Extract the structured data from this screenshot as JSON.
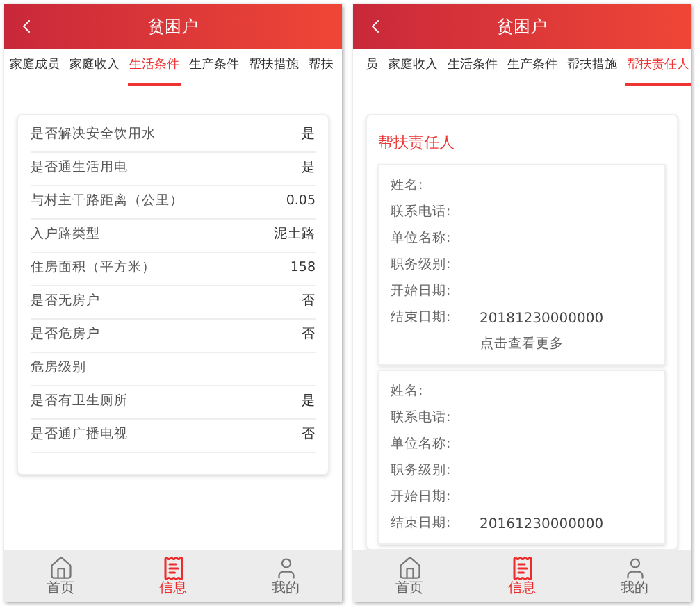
{
  "screens": [
    {
      "title": "贫困户",
      "tabs": [
        {
          "label": "家庭成员",
          "selected": false
        },
        {
          "label": "家庭收入",
          "selected": false
        },
        {
          "label": "生活条件",
          "selected": true
        },
        {
          "label": "生产条件",
          "selected": false
        },
        {
          "label": "帮扶措施",
          "selected": false
        },
        {
          "label": "帮扶",
          "selected": false
        }
      ],
      "content": {
        "kind": "table",
        "rows": [
          {
            "label": "是否解决安全饮用水",
            "value": "是"
          },
          {
            "label": "是否通生活用电",
            "value": "是"
          },
          {
            "label": "与村主干路距离（公里）",
            "value": "0.05"
          },
          {
            "label": "入户路类型",
            "value": "泥土路"
          },
          {
            "label": "住房面积（平方米）",
            "value": "158"
          },
          {
            "label": "是否无房户",
            "value": "否"
          },
          {
            "label": "是否危房户",
            "value": "否"
          },
          {
            "label": "危房级别"
          },
          {
            "label": "是否有卫生厕所",
            "value": "是"
          },
          {
            "label": "是否通广播电视",
            "value": "否"
          }
        ]
      },
      "nav": [
        {
          "label": "首页",
          "selected": false
        },
        {
          "label": "信息",
          "selected": true
        },
        {
          "label": "我的",
          "selected": false
        }
      ]
    },
    {
      "title": "贫困户",
      "tabs": [
        {
          "label": "员",
          "selected": false
        },
        {
          "label": "家庭收入",
          "selected": false
        },
        {
          "label": "生活条件",
          "selected": false
        },
        {
          "label": "生产条件",
          "selected": false
        },
        {
          "label": "帮扶措施",
          "selected": false
        },
        {
          "label": "帮扶责任人",
          "selected": true
        }
      ],
      "content": {
        "kind": "persons",
        "heading": "帮扶责任人",
        "persons": [
          {
            "fields": [
              {
                "label": "姓名:"
              },
              {
                "label": "联系电话:"
              },
              {
                "label": "单位名称:"
              },
              {
                "label": "职务级别:"
              },
              {
                "label": "开始日期:"
              },
              {
                "label": "结束日期:",
                "value": "20181230000000"
              }
            ],
            "more": "点击查看更多"
          },
          {
            "fields": [
              {
                "label": "姓名:"
              },
              {
                "label": "联系电话:"
              },
              {
                "label": "单位名称:"
              },
              {
                "label": "职务级别:"
              },
              {
                "label": "开始日期:"
              },
              {
                "label": "结束日期:",
                "value": "20161230000000"
              }
            ]
          }
        ]
      },
      "nav": [
        {
          "label": "首页",
          "selected": false
        },
        {
          "label": "信息",
          "selected": true
        },
        {
          "label": "我的",
          "selected": false
        }
      ]
    }
  ]
}
